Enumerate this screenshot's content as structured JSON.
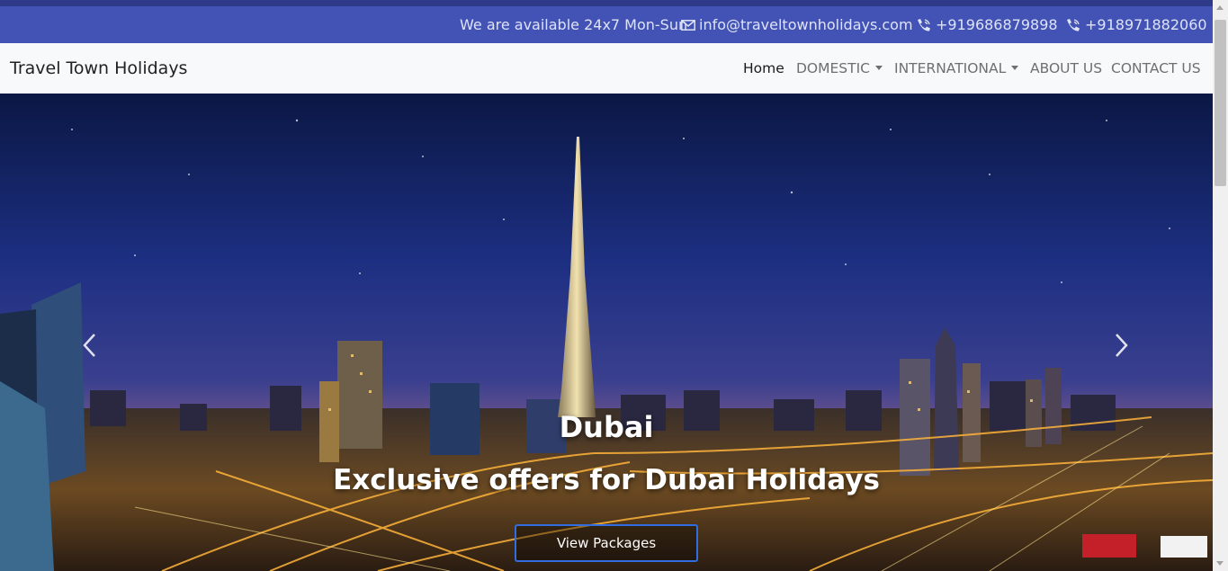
{
  "topbar": {
    "availability": "We are available 24x7 Mon-Sun",
    "email": "info@traveltownholidays.com",
    "phone1": "+919686879898",
    "phone2": "+918971882060",
    "icons": [
      "envelope-icon",
      "phone-icon",
      "phone-icon"
    ]
  },
  "navbar": {
    "brand": "Travel Town Holidays",
    "links": [
      "Home",
      "DOMESTIC",
      "INTERNATIONAL",
      "ABOUT US",
      "CONTACT US"
    ]
  },
  "hero": {
    "title": "Dubai",
    "subtitle": "Exclusive offers for Dubai Holidays",
    "button": "View Packages"
  },
  "colors": {
    "topbar_bg": "#4253b5",
    "navbar_bg": "#f8f9fa",
    "button_border": "#2f6de0"
  }
}
